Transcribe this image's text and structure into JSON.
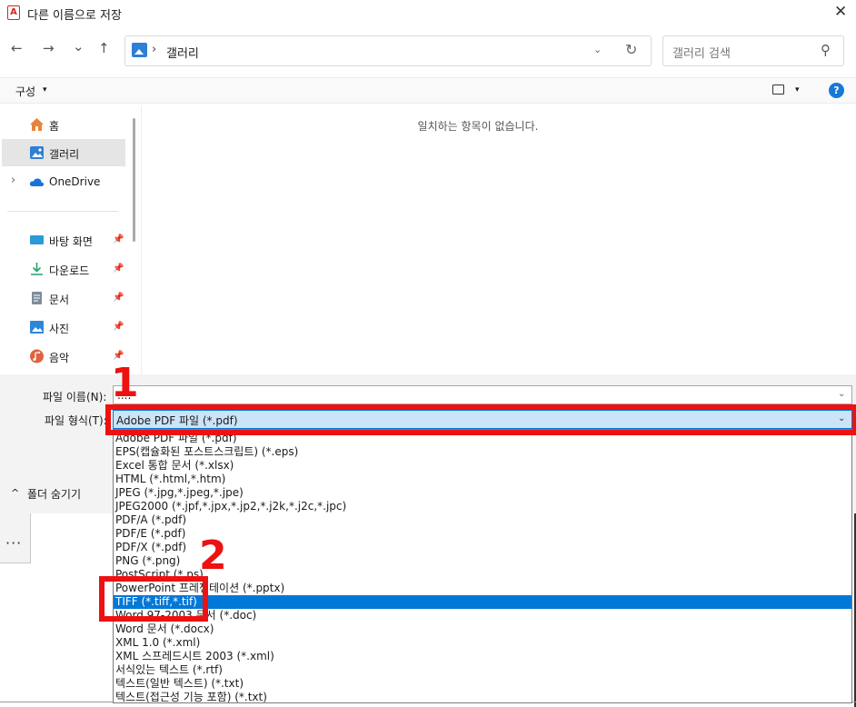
{
  "window": {
    "title": "다른 이름으로 저장",
    "close": "✕"
  },
  "nav": {
    "back": "←",
    "forward": "→",
    "recent": "⌄",
    "up": "↑",
    "address_sep": "›",
    "address": "갤러리",
    "address_dropdown": "⌄",
    "refresh": "↻",
    "search_placeholder": "갤러리 검색",
    "search_icon": "⚲"
  },
  "toolbar": {
    "organize": "구성",
    "caret": "▾",
    "help": "?"
  },
  "sidebar": {
    "items": [
      {
        "label": "홈",
        "icon": "home-icon",
        "color": "#e8833a"
      },
      {
        "label": "갤러리",
        "icon": "gallery-icon",
        "color": "#2f7fd4",
        "selected": true
      },
      {
        "label": "OneDrive",
        "icon": "cloud-icon",
        "color": "#1a73d9",
        "expand": "›"
      }
    ],
    "pinned": [
      {
        "label": "바탕 화면",
        "icon": "desktop-icon",
        "color": "#2c9ad6"
      },
      {
        "label": "다운로드",
        "icon": "download-icon",
        "color": "#23a26b"
      },
      {
        "label": "문서",
        "icon": "documents-icon",
        "color": "#7f8c9d"
      },
      {
        "label": "사진",
        "icon": "pictures-icon",
        "color": "#2e86d6"
      },
      {
        "label": "음악",
        "icon": "music-icon",
        "color": "#e0633f"
      }
    ],
    "pin_glyph": "📌"
  },
  "main": {
    "empty_message": "일치하는 항목이 없습니다."
  },
  "fields": {
    "filename_label": "파일 이름(N):",
    "filename_value": "....",
    "filetype_label": "파일 형식(T):",
    "filetype_value": "Adobe PDF 파일 (*.pdf)",
    "chevron": "⌄",
    "hide_folders": "폴더 숨기기",
    "hide_caret": "^"
  },
  "dropdown": {
    "options": [
      "Adobe PDF 파일 (*.pdf)",
      "EPS(캡슐화된 포스트스크립트) (*.eps)",
      "Excel 통합 문서 (*.xlsx)",
      "HTML (*.html,*.htm)",
      "JPEG (*.jpg,*.jpeg,*.jpe)",
      "JPEG2000 (*.jpf,*.jpx,*.jp2,*.j2k,*.j2c,*.jpc)",
      "PDF/A (*.pdf)",
      "PDF/E (*.pdf)",
      "PDF/X (*.pdf)",
      "PNG (*.png)",
      "PostScript (*.ps)",
      "PowerPoint 프레젠테이션 (*.pptx)",
      "TIFF (*.tiff,*.tif)",
      "Word 97-2003 문서 (*.doc)",
      "Word 문서 (*.docx)",
      "XML 1.0 (*.xml)",
      "XML 스프레드시트 2003 (*.xml)",
      "서식있는 텍스트 (*.rtf)",
      "텍스트(일반 텍스트) (*.txt)",
      "텍스트(접근성 기능 포함) (*.txt)"
    ],
    "selected_index": 12
  },
  "annotations": {
    "step1": "1",
    "step2": "2",
    "color": "#ee1111"
  },
  "background_app": {
    "pen_glyph": "✍",
    "more": "···"
  }
}
